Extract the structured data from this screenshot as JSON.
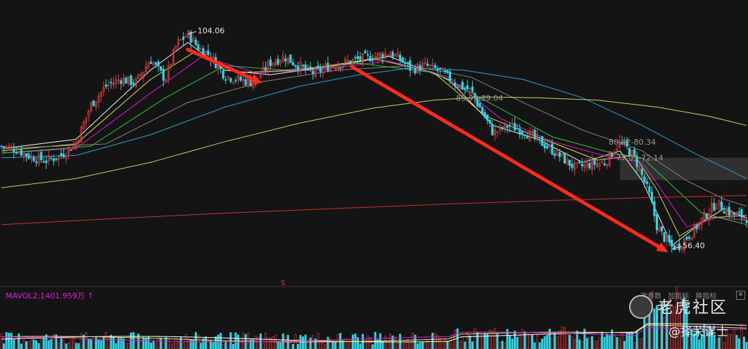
{
  "chart_data": {
    "type": "candlestick",
    "price_range": [
      50,
      110
    ],
    "markers": {
      "high": "104.06",
      "low": "56.40",
      "signal": "S"
    },
    "price_zones": [
      {
        "label": "89.99-89.04",
        "low": 89.04,
        "high": 89.99
      },
      {
        "label": "80.42-80.34",
        "low": 80.34,
        "high": 80.42
      },
      {
        "label": "77.03-72.14",
        "low": 72.14,
        "high": 77.03
      }
    ],
    "trend_arrows": [
      {
        "from": [
          0.25,
          100.5
        ],
        "to": [
          0.35,
          93.2
        ]
      },
      {
        "from": [
          0.47,
          96.8
        ],
        "to": [
          0.895,
          56.5
        ]
      }
    ],
    "price_path": [
      [
        0.0,
        79.5
      ],
      [
        0.02,
        78.8
      ],
      [
        0.04,
        77.2
      ],
      [
        0.06,
        76.4
      ],
      [
        0.08,
        77.5
      ],
      [
        0.1,
        80.2
      ],
      [
        0.12,
        88.4
      ],
      [
        0.14,
        92.5
      ],
      [
        0.16,
        94.1
      ],
      [
        0.18,
        93.2
      ],
      [
        0.2,
        98.4
      ],
      [
        0.22,
        94.0
      ],
      [
        0.235,
        101.6
      ],
      [
        0.25,
        103.8
      ],
      [
        0.265,
        100.8
      ],
      [
        0.28,
        99.2
      ],
      [
        0.3,
        94.8
      ],
      [
        0.32,
        93.9
      ],
      [
        0.34,
        93.2
      ],
      [
        0.36,
        97.6
      ],
      [
        0.38,
        98.9
      ],
      [
        0.4,
        96.8
      ],
      [
        0.42,
        95.3
      ],
      [
        0.44,
        96.9
      ],
      [
        0.46,
        97.6
      ],
      [
        0.48,
        98.4
      ],
      [
        0.5,
        99.0
      ],
      [
        0.52,
        99.8
      ],
      [
        0.535,
        98.4
      ],
      [
        0.55,
        96.2
      ],
      [
        0.57,
        97.0
      ],
      [
        0.59,
        95.7
      ],
      [
        0.61,
        93.0
      ],
      [
        0.63,
        91.6
      ],
      [
        0.66,
        82.4
      ],
      [
        0.68,
        84.0
      ],
      [
        0.7,
        82.9
      ],
      [
        0.72,
        80.8
      ],
      [
        0.74,
        78.6
      ],
      [
        0.77,
        74.8
      ],
      [
        0.79,
        75.6
      ],
      [
        0.81,
        76.0
      ],
      [
        0.83,
        80.4
      ],
      [
        0.84,
        79.0
      ],
      [
        0.85,
        77.0
      ],
      [
        0.86,
        73.0
      ],
      [
        0.87,
        68.7
      ],
      [
        0.88,
        62.0
      ],
      [
        0.89,
        59.6
      ],
      [
        0.9,
        57.6
      ],
      [
        0.91,
        58.0
      ],
      [
        0.93,
        61.5
      ],
      [
        0.95,
        65.6
      ],
      [
        0.96,
        67.2
      ],
      [
        0.97,
        66.0
      ],
      [
        0.98,
        64.8
      ],
      [
        0.99,
        64.5
      ],
      [
        1.0,
        64.0
      ]
    ],
    "moving_averages": [
      {
        "color": "#ffffff",
        "points": [
          [
            0.0,
            79.0
          ],
          [
            0.1,
            81.0
          ],
          [
            0.2,
            96.0
          ],
          [
            0.25,
            102.0
          ],
          [
            0.3,
            96.0
          ],
          [
            0.36,
            95.0
          ],
          [
            0.45,
            97.0
          ],
          [
            0.52,
            99.0
          ],
          [
            0.6,
            94.0
          ],
          [
            0.66,
            84.0
          ],
          [
            0.72,
            81.0
          ],
          [
            0.78,
            76.0
          ],
          [
            0.83,
            78.5
          ],
          [
            0.86,
            72.0
          ],
          [
            0.9,
            58.0
          ],
          [
            0.94,
            63.0
          ],
          [
            0.97,
            66.0
          ],
          [
            1.0,
            64.0
          ]
        ]
      },
      {
        "color": "#e8e85a",
        "points": [
          [
            0.0,
            78.5
          ],
          [
            0.1,
            80.0
          ],
          [
            0.2,
            94.0
          ],
          [
            0.26,
            100.0
          ],
          [
            0.32,
            95.5
          ],
          [
            0.4,
            96.0
          ],
          [
            0.5,
            98.5
          ],
          [
            0.58,
            95.5
          ],
          [
            0.65,
            86.0
          ],
          [
            0.72,
            81.5
          ],
          [
            0.8,
            76.5
          ],
          [
            0.85,
            77.5
          ],
          [
            0.88,
            70.0
          ],
          [
            0.91,
            60.0
          ],
          [
            0.95,
            64.0
          ],
          [
            1.0,
            64.5
          ]
        ]
      },
      {
        "color": "#e020e0",
        "points": [
          [
            0.0,
            78.0
          ],
          [
            0.1,
            79.0
          ],
          [
            0.2,
            91.0
          ],
          [
            0.27,
            99.0
          ],
          [
            0.34,
            95.5
          ],
          [
            0.42,
            96.0
          ],
          [
            0.52,
            98.0
          ],
          [
            0.6,
            94.5
          ],
          [
            0.67,
            85.5
          ],
          [
            0.74,
            80.5
          ],
          [
            0.82,
            77.0
          ],
          [
            0.86,
            76.0
          ],
          [
            0.89,
            69.0
          ],
          [
            0.92,
            62.0
          ],
          [
            0.96,
            64.0
          ],
          [
            1.0,
            63.5
          ]
        ]
      },
      {
        "color": "#30d040",
        "points": [
          [
            0.0,
            78.0
          ],
          [
            0.12,
            79.5
          ],
          [
            0.22,
            90.0
          ],
          [
            0.3,
            97.0
          ],
          [
            0.38,
            96.0
          ],
          [
            0.48,
            97.5
          ],
          [
            0.58,
            95.5
          ],
          [
            0.66,
            88.5
          ],
          [
            0.74,
            81.5
          ],
          [
            0.82,
            78.0
          ],
          [
            0.86,
            77.0
          ],
          [
            0.9,
            71.0
          ],
          [
            0.94,
            65.0
          ],
          [
            1.0,
            62.5
          ]
        ]
      },
      {
        "color": "#8a8a8a",
        "points": [
          [
            0.0,
            79.0
          ],
          [
            0.14,
            80.0
          ],
          [
            0.25,
            89.0
          ],
          [
            0.35,
            93.5
          ],
          [
            0.45,
            96.0
          ],
          [
            0.55,
            97.0
          ],
          [
            0.63,
            94.5
          ],
          [
            0.7,
            89.0
          ],
          [
            0.78,
            83.0
          ],
          [
            0.86,
            78.5
          ],
          [
            0.92,
            72.0
          ],
          [
            0.97,
            68.0
          ],
          [
            1.0,
            66.5
          ]
        ]
      },
      {
        "color": "#2aa8e0",
        "points": [
          [
            0.0,
            77.0
          ],
          [
            0.1,
            77.5
          ],
          [
            0.2,
            82.0
          ],
          [
            0.3,
            88.0
          ],
          [
            0.4,
            92.5
          ],
          [
            0.48,
            95.0
          ],
          [
            0.55,
            96.5
          ],
          [
            0.62,
            96.0
          ],
          [
            0.7,
            94.0
          ],
          [
            0.78,
            90.0
          ],
          [
            0.86,
            84.0
          ],
          [
            0.93,
            78.0
          ],
          [
            1.0,
            72.5
          ]
        ]
      },
      {
        "color": "#d8d86a",
        "points": [
          [
            0.0,
            70.5
          ],
          [
            0.1,
            72.5
          ],
          [
            0.2,
            76.0
          ],
          [
            0.3,
            80.5
          ],
          [
            0.4,
            84.5
          ],
          [
            0.5,
            87.8
          ],
          [
            0.58,
            89.5
          ],
          [
            0.65,
            90.2
          ],
          [
            0.72,
            90.0
          ],
          [
            0.8,
            89.5
          ],
          [
            0.88,
            88.0
          ],
          [
            0.95,
            86.0
          ],
          [
            1.0,
            84.0
          ]
        ]
      },
      {
        "color": "#d83030",
        "points": [
          [
            0.0,
            62.5
          ],
          [
            0.15,
            63.8
          ],
          [
            0.3,
            65.0
          ],
          [
            0.45,
            66.0
          ],
          [
            0.6,
            67.0
          ],
          [
            0.75,
            67.8
          ],
          [
            0.9,
            68.5
          ],
          [
            1.0,
            68.8
          ]
        ]
      }
    ],
    "volume_indicator": "MAVOL2:1401.959万 ↑"
  },
  "toolbar": {
    "items": [
      "改参数",
      "加指标",
      "换指标"
    ],
    "close_label": "✕"
  },
  "watermark": {
    "brand": "老虎社区",
    "user": "@择荣谋士"
  },
  "colors": {
    "background": "#141414",
    "up": "#e23b3b",
    "down": "#2fd4e6",
    "arrow": "#ff2a1a",
    "volume_label": "#e01ee0",
    "zone_band": "#3a3a3a"
  }
}
